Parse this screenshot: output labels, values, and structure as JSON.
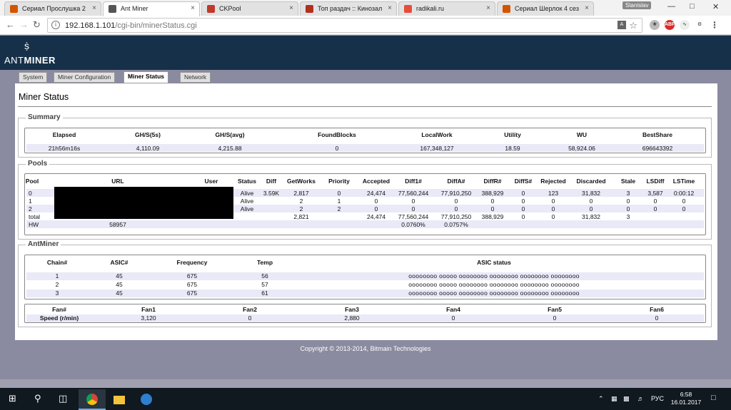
{
  "browser": {
    "tabs": [
      {
        "label": "Сериал Прослушка 2",
        "icon": "page-icon",
        "color": "#d35400"
      },
      {
        "label": "Ant Miner",
        "icon": "page-icon",
        "color": "#555555"
      },
      {
        "label": "CKPool",
        "icon": "page-icon",
        "color": "#c0392b"
      },
      {
        "label": "Топ раздач :: Кинозал",
        "icon": "k-icon",
        "color": "#b03020"
      },
      {
        "label": "radikali.ru",
        "icon": "r-icon",
        "color": "#e74c3c"
      },
      {
        "label": "Сериал Шерлок 4 сез",
        "icon": "page-icon",
        "color": "#d35400"
      }
    ],
    "user_badge": "Stanislav",
    "url_host": "192.168.1.101",
    "url_path": "/cgi-bin/minerStatus.cgi"
  },
  "app": {
    "logo_light": "ANT",
    "logo_bold": "MINER",
    "nav": [
      "System",
      "Miner Configuration",
      "Miner Status",
      "Network"
    ],
    "page_title": "Miner Status"
  },
  "summary": {
    "legend": "Summary",
    "headers": [
      "Elapsed",
      "GH/S(5s)",
      "GH/S(avg)",
      "FoundBlocks",
      "LocalWork",
      "Utility",
      "WU",
      "BestShare"
    ],
    "values": [
      "21h56m16s",
      "4,110.09",
      "4,215.88",
      "0",
      "167,348,127",
      "18.59",
      "58,924.06",
      "696643392"
    ]
  },
  "pools": {
    "legend": "Pools",
    "headers": [
      "Pool",
      "URL",
      "User",
      "Status",
      "Diff",
      "GetWorks",
      "Priority",
      "Accepted",
      "Diff1#",
      "DiffA#",
      "DiffR#",
      "DiffS#",
      "Rejected",
      "Discarded",
      "Stale",
      "LSDiff",
      "LSTime"
    ],
    "rows": [
      [
        "0",
        "",
        "",
        "Alive",
        "3.59K",
        "2,817",
        "0",
        "24,474",
        "77,560,244",
        "77,910,250",
        "388,929",
        "0",
        "123",
        "31,832",
        "3",
        "3,587",
        "0:00:12"
      ],
      [
        "1",
        "",
        "",
        "Alive",
        "",
        "2",
        "1",
        "0",
        "0",
        "0",
        "0",
        "0",
        "0",
        "0",
        "0",
        "0",
        "0"
      ],
      [
        "2",
        "",
        "",
        "Alive",
        "",
        "2",
        "2",
        "0",
        "0",
        "0",
        "0",
        "0",
        "0",
        "0",
        "0",
        "0",
        "0"
      ],
      [
        "total",
        "",
        "",
        "",
        "",
        "2,821",
        "",
        "24,474",
        "77,560,244",
        "77,910,250",
        "388,929",
        "0",
        "0",
        "31,832",
        "3",
        "",
        ""
      ],
      [
        "HW",
        "58957",
        "",
        "",
        "",
        "",
        "",
        "",
        "0.0760%",
        "0.0757%",
        "",
        "",
        "",
        "",
        "",
        "",
        ""
      ]
    ]
  },
  "antminer": {
    "legend": "AntMiner",
    "chain_headers": [
      "Chain#",
      "ASIC#",
      "Frequency",
      "Temp",
      "ASIC status"
    ],
    "chains": [
      [
        "1",
        "45",
        "675",
        "56",
        "oooooooo ooooo oooooooo oooooooo oooooooo oooooooo"
      ],
      [
        "2",
        "45",
        "675",
        "57",
        "oooooooo ooooo oooooooo oooooooo oooooooo oooooooo"
      ],
      [
        "3",
        "45",
        "675",
        "61",
        "oooooooo ooooo oooooooo oooooooo oooooooo oooooooo"
      ]
    ],
    "fan_headers": [
      "Fan#",
      "Fan1",
      "Fan2",
      "Fan3",
      "Fan4",
      "Fan5",
      "Fan6"
    ],
    "fan_values": [
      "Speed (r/min)",
      "3,120",
      "0",
      "2,880",
      "0",
      "0",
      "0"
    ]
  },
  "footer": "Copyright © 2013-2014, Bitmain Technologies",
  "taskbar": {
    "lang": "РУС",
    "time": "6:58",
    "date": "16.01.2017"
  }
}
